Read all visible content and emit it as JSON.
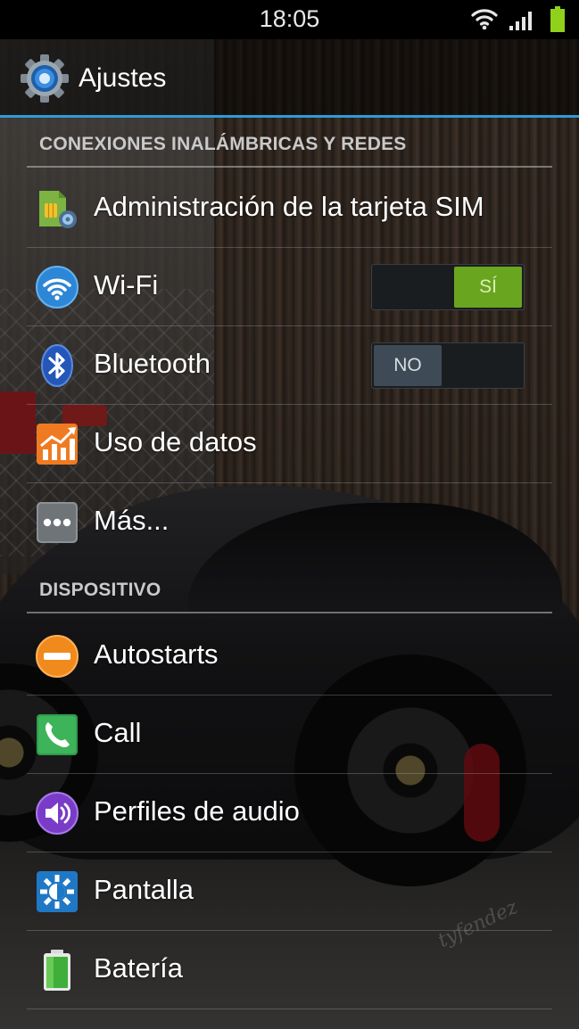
{
  "status_bar": {
    "time": "18:05"
  },
  "action_bar": {
    "title": "Ajustes"
  },
  "sections": {
    "wireless": {
      "header": "CONEXIONES INALÁMBRICAS Y REDES",
      "sim": "Administración de la tarjeta SIM",
      "wifi": {
        "label": "Wi-Fi",
        "toggle": "SÍ",
        "state": "on"
      },
      "bluetooth": {
        "label": "Bluetooth",
        "toggle": "NO",
        "state": "off"
      },
      "data_usage": "Uso de datos",
      "more": "Más..."
    },
    "device": {
      "header": "DISPOSITIVO",
      "autostarts": "Autostarts",
      "call": "Call",
      "audio_profiles": "Perfiles de audio",
      "display": "Pantalla",
      "battery": "Batería"
    }
  },
  "colors": {
    "accent_blue": "#2f9bd6",
    "toggle_on": "#6aa51f",
    "toggle_off": "#3e4a55",
    "battery_green": "#8fd11b"
  },
  "icons": {
    "app": "settings-gear-icon",
    "sim": "sim-card-settings-icon",
    "wifi": "wifi-icon",
    "bluetooth": "bluetooth-icon",
    "data_usage": "data-usage-chart-icon",
    "more": "more-dots-icon",
    "autostarts": "autostarts-minus-icon",
    "call": "phone-call-icon",
    "audio_profiles": "speaker-icon",
    "display": "brightness-icon",
    "battery": "battery-icon"
  },
  "wallpaper": {
    "signature": "tyfendez"
  }
}
